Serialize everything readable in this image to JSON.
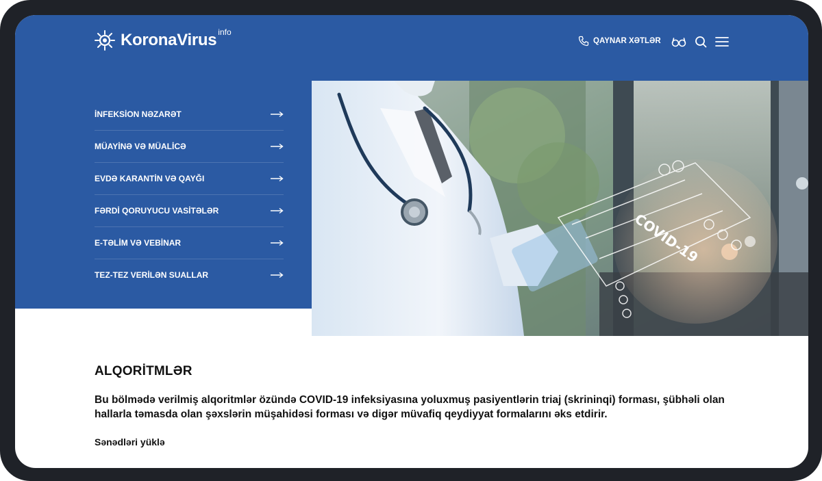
{
  "header": {
    "logo_text": "KoronaVirus",
    "logo_sup": "info",
    "hotline_label": "QAYNAR XƏTLƏR",
    "icons": [
      "phone-icon",
      "glasses-icon",
      "search-icon",
      "hamburger-menu-icon"
    ]
  },
  "menu": {
    "items": [
      {
        "label": "İNFEKSİON NƏZARƏT"
      },
      {
        "label": "MÜAYİNƏ VƏ MÜALİCƏ"
      },
      {
        "label": "EVDƏ KARANTİN VƏ QAYĞI"
      },
      {
        "label": "FƏRDİ QORUYUCU VASİTƏLƏR"
      },
      {
        "label": "E-TƏLİM VƏ VEBİNAR"
      },
      {
        "label": "TEZ-TEZ VERİLƏN SUALLAR"
      }
    ]
  },
  "hero_image": {
    "overlay_text": "COVID-19"
  },
  "main": {
    "title": "ALQORİTMLƏR",
    "description": "Bu bölmədə verilmiş alqoritmlər özündə COVID-19 infeksiyasına yoluxmuş pasiyentlərin triaj (skrininqi) forması, şübhəli olan hallarla təmasda olan şəxslərin müşahidəsi forması və digər müvafiq qeydiyyat formalarını əks etdirir.",
    "download_label": "Sənədləri yüklə"
  },
  "colors": {
    "brand_blue": "#2b5aa3",
    "frame": "#1f2228",
    "text": "#111111"
  }
}
